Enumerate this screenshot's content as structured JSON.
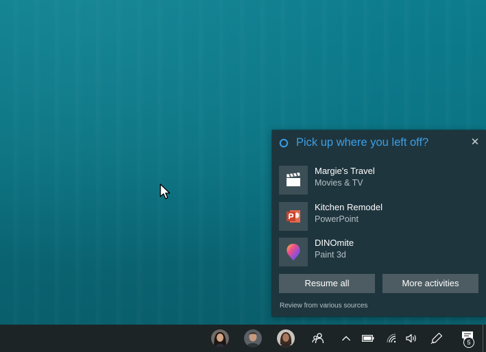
{
  "panel": {
    "title": "Pick up where you left off?",
    "close_symbol": "✕",
    "activities": [
      {
        "name": "Margie's Travel",
        "app": "Movies & TV",
        "icon": "clapperboard-icon"
      },
      {
        "name": "Kitchen Remodel",
        "app": "PowerPoint",
        "icon": "powerpoint-icon"
      },
      {
        "name": "DINOmite",
        "app": "Paint 3d",
        "icon": "paint3d-icon"
      }
    ],
    "resume_all_label": "Resume all",
    "more_activities_label": "More activities",
    "footer": "Review from various sources"
  },
  "taskbar": {
    "notification_count": "5",
    "icons": [
      "avatar-1",
      "avatar-2",
      "avatar-3",
      "people-icon",
      "chevron-up-icon",
      "battery-icon",
      "wifi-icon",
      "volume-icon",
      "pen-icon",
      "action-center-icon"
    ]
  },
  "colors": {
    "accent": "#3a9fe8",
    "panel_bg": "#1f353d",
    "button_bg": "#4c5c62",
    "taskbar_bg": "#1d2426",
    "powerpoint": "#c9432c"
  }
}
